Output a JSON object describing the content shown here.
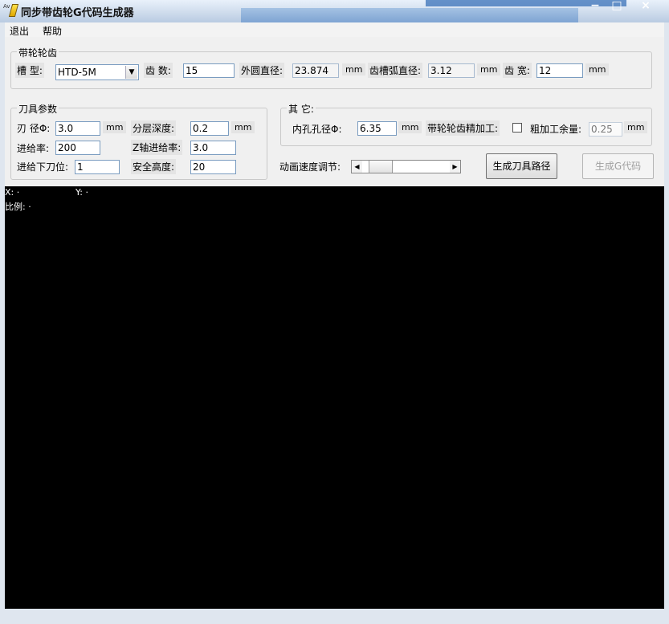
{
  "window": {
    "title": "同步带齿轮G代码生成器",
    "icon_text": "Av G",
    "controls": [
      "−",
      "□",
      "×"
    ]
  },
  "menu": [
    "退出",
    "帮助"
  ],
  "belt_tooth": {
    "title": "带轮轮齿",
    "groove_type_label": "槽 型:",
    "groove_type_value": "HTD-5M",
    "tooth_count_label": "齿 数:",
    "tooth_count_value": "15",
    "outer_dia_label": "外圆直径:",
    "outer_dia_value": "23.874",
    "outer_dia_unit": "mm",
    "arc_dia_label": "齿槽弧直径:",
    "arc_dia_value": "3.12",
    "arc_dia_unit": "mm",
    "tooth_width_label": "齿 宽:",
    "tooth_width_value": "12",
    "tooth_width_unit": "mm"
  },
  "tool": {
    "title": "刀具参数",
    "blade_dia_label": "刃 径Φ:",
    "blade_dia_value": "3.0",
    "blade_dia_unit": "mm",
    "layer_depth_label": "分层深度:",
    "layer_depth_value": "0.2",
    "layer_depth_unit": "mm",
    "feed_rate_label": "进给率:",
    "feed_rate_value": "200",
    "z_feed_label": "Z轴进给率:",
    "z_feed_value": "3.0",
    "plunge_label": "进给下刀位:",
    "plunge_value": "1",
    "safe_height_label": "安全高度:",
    "safe_height_value": "20"
  },
  "other": {
    "title": "其 它:",
    "bore_label": "内孔孔径Φ:",
    "bore_value": "6.35",
    "bore_unit": "mm",
    "finish_label": "带轮轮齿精加工:",
    "finish_checked": false,
    "rough_label": "粗加工余量:",
    "rough_value": "0.25",
    "rough_unit": "mm"
  },
  "animation": {
    "label": "动画速度调节:",
    "speed_fraction": 0.1
  },
  "buttons": {
    "gen_path": "生成刀具路径",
    "gen_gcode": "生成G代码"
  },
  "canvas": {
    "x_label": "X: ·",
    "y_label": "Y: ·",
    "scale_label": "比例: ·"
  }
}
